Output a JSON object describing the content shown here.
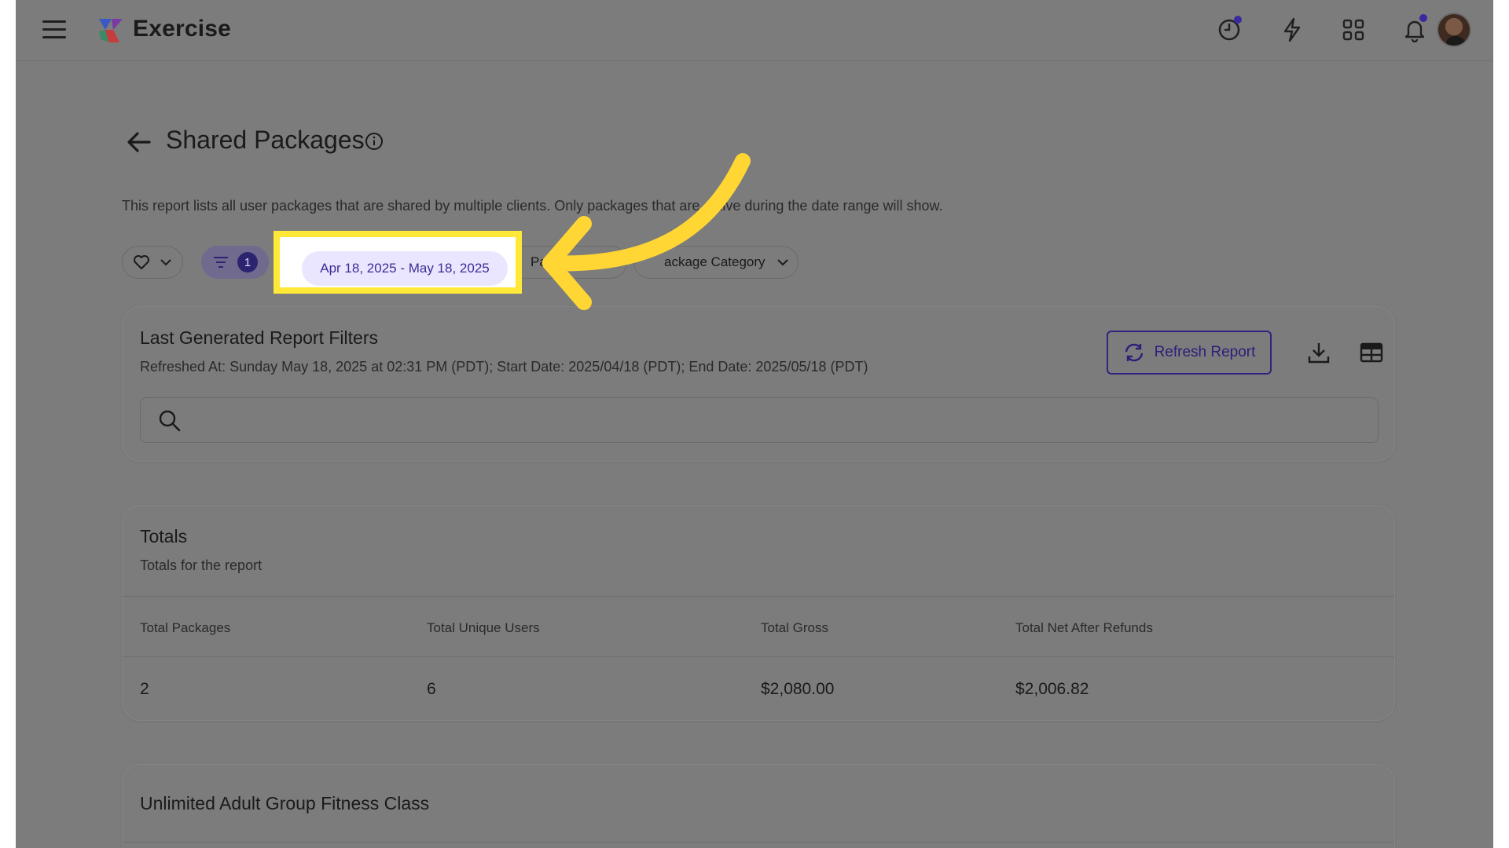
{
  "app": {
    "title": "Exercise"
  },
  "header_icons": [
    "history-icon",
    "lightning-icon",
    "apps-grid-icon",
    "bell-icon"
  ],
  "page": {
    "title": "Shared Packages",
    "description": "This report lists all user packages that are shared by multiple clients. Only packages that are active during the date range will show."
  },
  "filters": {
    "active_count": "1",
    "date_range": "Apr 18, 2025 - May 18, 2025",
    "package_label_partial": "Pa",
    "package_category": "ackage Category"
  },
  "last_generated": {
    "title": "Last Generated Report Filters",
    "details": "Refreshed At: Sunday May 18, 2025 at 02:31 PM (PDT); Start Date: 2025/04/18 (PDT); End Date: 2025/05/18 (PDT)",
    "refresh_label": "Refresh Report",
    "search_placeholder": ""
  },
  "totals": {
    "title": "Totals",
    "subtitle": "Totals for the report",
    "columns": [
      "Total Packages",
      "Total Unique Users",
      "Total Gross",
      "Total Net After Refunds"
    ],
    "values": [
      "2",
      "6",
      "$2,080.00",
      "$2,006.82"
    ]
  },
  "package_section": {
    "title": "Unlimited Adult Group Fitness Class"
  },
  "colors": {
    "overlay_gray": "#7c7c7c",
    "highlight": "#ffe838",
    "accent": "#2f2580",
    "date_pill_bg": "#ebe6ff"
  }
}
